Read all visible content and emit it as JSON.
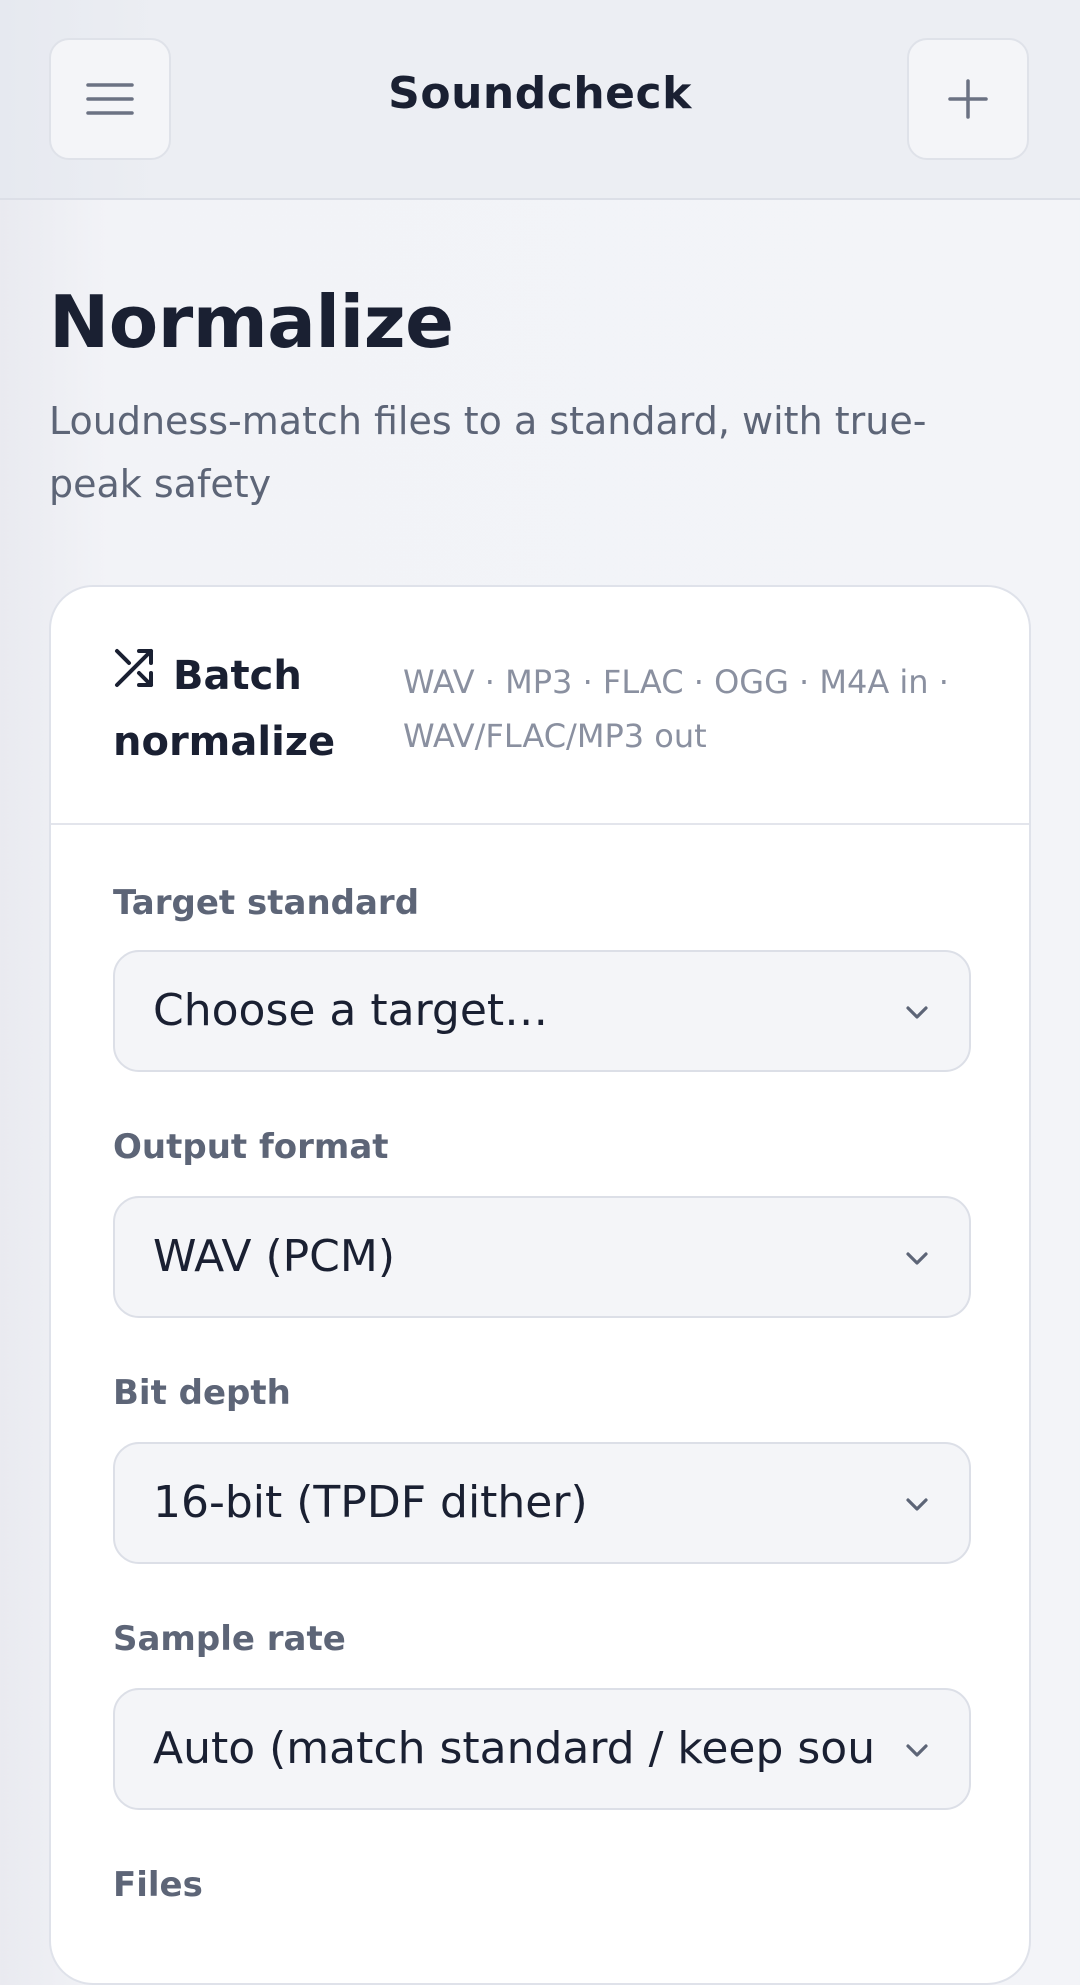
{
  "header": {
    "title": "Soundcheck",
    "menu_icon": "menu-icon",
    "add_icon": "plus-icon"
  },
  "page": {
    "title": "Normalize",
    "subtitle": "Loudness-match files to a standard, with true-peak safety"
  },
  "card": {
    "icon": "shuffle-icon",
    "title": "Batch normalize",
    "meta": "WAV · MP3 · FLAC · OGG · M4A in · WAV/FLAC/MP3 out",
    "fields": {
      "target": {
        "label": "Target standard",
        "value": "Choose a target…"
      },
      "format": {
        "label": "Output format",
        "value": "WAV (PCM)"
      },
      "bitdepth": {
        "label": "Bit depth",
        "value": "16-bit (TPDF dither)"
      },
      "samplerate": {
        "label": "Sample rate",
        "value": "Auto (match standard / keep source)"
      },
      "files": {
        "label": "Files"
      }
    }
  },
  "colors": {
    "text_primary": "#1a2032",
    "text_secondary": "#5d6577",
    "text_muted": "#8a90a0",
    "border": "#dcdfe7",
    "surface": "#f4f5f8"
  }
}
